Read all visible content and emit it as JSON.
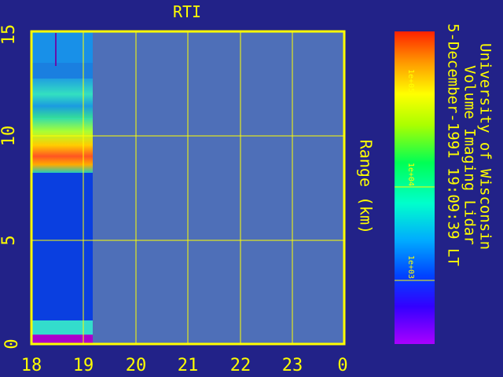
{
  "plot": {
    "title": "RTI",
    "ylabel": "Range (km)",
    "y_ticks": [
      "0",
      "5",
      "10",
      "15"
    ],
    "x_ticks": [
      "18",
      "19",
      "20",
      "21",
      "22",
      "23",
      "0"
    ],
    "axis_color": "#FFFF00",
    "background_color": "#222288",
    "empty_region_color": "#4E6FB8"
  },
  "colorbar": {
    "tick_labels": [
      "1e+05",
      "1e+04",
      "1e+03"
    ]
  },
  "caption": {
    "line1": "University of Wisconsin",
    "line2": "Volume Imaging Lidar",
    "line3": "5-December-1991 19:09:39 LT"
  },
  "chart_data": {
    "type": "heatmap",
    "title": "RTI",
    "xlabel": "",
    "ylabel": "Range (km)",
    "xlim": [
      18,
      24
    ],
    "ylim": [
      0,
      15
    ],
    "x_tick_labels": [
      "18",
      "19",
      "20",
      "21",
      "22",
      "23",
      "0"
    ],
    "data_x_range": [
      18.0,
      19.16
    ],
    "color_scale": "log",
    "color_ticks": [
      "1e+03",
      "1e+04",
      "1e+05"
    ],
    "features": [
      {
        "range_km": [
          0.0,
          0.4
        ],
        "level": "low"
      },
      {
        "range_km": [
          0.4,
          1.3
        ],
        "level": "medium"
      },
      {
        "range_km": [
          8.2,
          10.2
        ],
        "level": "very high"
      },
      {
        "range_km": [
          10.2,
          12.6
        ],
        "level": "medium"
      }
    ]
  }
}
